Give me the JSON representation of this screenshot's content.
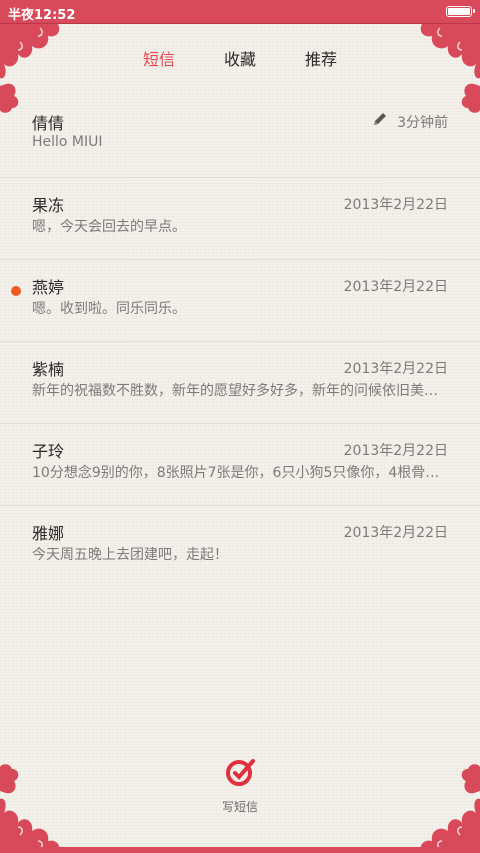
{
  "status_bar": {
    "time": "半夜12:52",
    "battery_icon": "battery-icon"
  },
  "tabs": [
    {
      "label": "短信",
      "active": true
    },
    {
      "label": "收藏",
      "active": false
    },
    {
      "label": "推荐",
      "active": false
    }
  ],
  "messages": [
    {
      "name": "倩倩",
      "preview": "Hello MIUI",
      "time": "3分钟前",
      "draft": true,
      "unread": false
    },
    {
      "name": "果冻",
      "preview": "嗯，今天会回去的早点。",
      "time": "2013年2月22日",
      "draft": false,
      "unread": false
    },
    {
      "name": "燕婷",
      "preview": "嗯。收到啦。同乐同乐。",
      "time": "2013年2月22日",
      "draft": false,
      "unread": true
    },
    {
      "name": "紫楠",
      "preview": "新年的祝福数不胜数，新年的愿望好多好多，新年的问候依旧美好…",
      "time": "2013年2月22日",
      "draft": false,
      "unread": false
    },
    {
      "name": "子玲",
      "preview": "10分想念9别的你，8张照片7张是你，6只小狗5只像你，4根骨头…",
      "time": "2013年2月22日",
      "draft": false,
      "unread": false
    },
    {
      "name": "雅娜",
      "preview": "今天周五晚上去团建吧，走起！",
      "time": "2013年2月22日",
      "draft": false,
      "unread": false
    }
  ],
  "compose": {
    "label": "写短信",
    "icon": "compose-icon"
  },
  "colors": {
    "accent": "#e8484e",
    "status_bar": "#d8495a",
    "unread_dot": "#f05a22"
  }
}
